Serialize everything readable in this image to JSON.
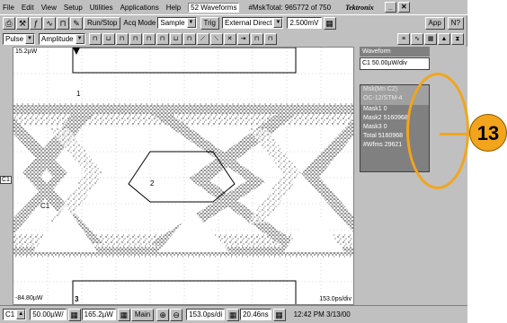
{
  "menu": {
    "items": [
      "File",
      "Edit",
      "View",
      "Setup",
      "Utilities",
      "Applications",
      "Help"
    ],
    "waveforms": "52 Waveforms",
    "mask_total": "#MskTotal: 965772 of 750",
    "brand": "Tektronix"
  },
  "toolbar": {
    "run_stop": "Run/Stop",
    "acq_mode_label": "Acq Mode",
    "acq_mode_value": "Sample",
    "trig_label": "Trig",
    "trig_value": "External Direct",
    "trig_level": "2.500mV",
    "app_label": "App",
    "help_label": "N?"
  },
  "toolbar2": {
    "pulse_value": "Pulse",
    "amplitude_value": "Amplitude"
  },
  "scope": {
    "top_level": "15.2µW",
    "bottom_level": "-84.80µW",
    "timescale": "153.0ps/div",
    "label_1": "1",
    "label_2": "2",
    "label_3": "3",
    "c1_label": "C1",
    "channel_marker": "C1",
    "left_marker": "C1"
  },
  "panel": {
    "title": "Waveform",
    "channel": "C1 50.00µW/div",
    "box_header_line1": "Msk(Mn C2)",
    "box_header_line2": "OC-12/STM-4",
    "rows": [
      {
        "label": "Mask1",
        "value": "0"
      },
      {
        "label": "Mask2",
        "value": "5160968"
      },
      {
        "label": "Mask3",
        "value": "0"
      },
      {
        "label": "Total",
        "value": "5160968"
      },
      {
        "label": "#Wfms",
        "value": "29621"
      }
    ]
  },
  "callout": {
    "number": "13",
    "color": "#f2a51c"
  },
  "bottom": {
    "channel": "C1",
    "scale": "50.00µW/",
    "offset": "165.2µW",
    "main_label": "Main",
    "timebase": "153.0ps/di",
    "position": "20.46ns",
    "clock": "12:42 PM 3/13/00"
  }
}
